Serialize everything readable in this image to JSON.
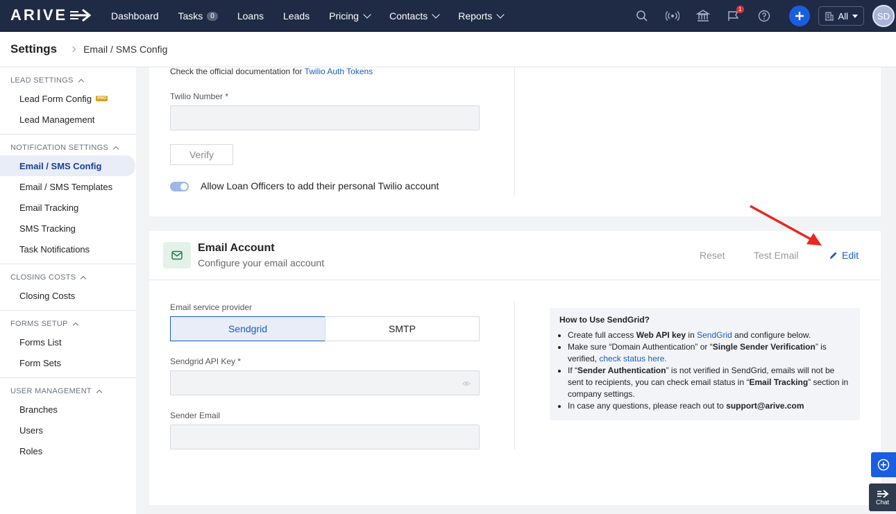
{
  "brand": {
    "logo_text": "ARIVE"
  },
  "nav": {
    "items": [
      {
        "label": "Dashboard"
      },
      {
        "label": "Tasks",
        "badge": "0"
      },
      {
        "label": "Loans"
      },
      {
        "label": "Leads"
      },
      {
        "label": "Pricing",
        "dropdown": true
      },
      {
        "label": "Contacts",
        "dropdown": true
      },
      {
        "label": "Reports",
        "dropdown": true
      }
    ],
    "notification_count": "1",
    "filter_label": "All",
    "avatar_initials": "SD"
  },
  "header": {
    "title": "Settings",
    "breadcrumb": "Email / SMS Config"
  },
  "sidebar": {
    "sections": [
      {
        "title": "LEAD SETTINGS",
        "items": [
          {
            "label": "Lead Form Config",
            "tag": "PRO"
          },
          {
            "label": "Lead Management"
          }
        ]
      },
      {
        "title": "NOTIFICATION SETTINGS",
        "items": [
          {
            "label": "Email / SMS Config",
            "active": true
          },
          {
            "label": "Email / SMS Templates"
          },
          {
            "label": "Email Tracking"
          },
          {
            "label": "SMS Tracking"
          },
          {
            "label": "Task Notifications"
          }
        ]
      },
      {
        "title": "CLOSING COSTS",
        "items": [
          {
            "label": "Closing Costs"
          }
        ]
      },
      {
        "title": "FORMS SETUP",
        "items": [
          {
            "label": "Forms List"
          },
          {
            "label": "Form Sets"
          }
        ]
      },
      {
        "title": "USER MANAGEMENT",
        "items": [
          {
            "label": "Branches"
          },
          {
            "label": "Users"
          },
          {
            "label": "Roles"
          }
        ]
      }
    ]
  },
  "twilio": {
    "doc_text": "Check the official documentation for ",
    "doc_link": "Twilio Auth Tokens",
    "number_label": "Twilio Number *",
    "number_value": "",
    "verify_label": "Verify",
    "toggle_label": "Allow Loan Officers to add their personal Twilio account",
    "toggle_on": true
  },
  "email_account": {
    "title": "Email Account",
    "subtitle": "Configure your email account",
    "reset_label": "Reset",
    "test_label": "Test Email",
    "edit_label": "Edit",
    "provider_label": "Email service provider",
    "providers": [
      "Sendgrid",
      "SMTP"
    ],
    "selected_provider": "Sendgrid",
    "api_key_label": "Sendgrid API Key *",
    "api_key_value": "",
    "sender_label": "Sender Email",
    "sender_value": ""
  },
  "howto": {
    "title": "How to Use SendGrid?",
    "l1a": "Create full access ",
    "l1b": "Web API key",
    "l1c": " in ",
    "l1d": "SendGrid",
    "l1e": " and configure below.",
    "l2a": "Make sure “Domain Authentication” or “",
    "l2b": "Single Sender Verification",
    "l2c": "” is verified, ",
    "l2d": "check status here.",
    "l3a": "If “",
    "l3b": "Sender Authentication",
    "l3c": "” is not verified in SendGrid, emails will not be sent to recipients, you can check email status in “",
    "l3d": "Email Tracking",
    "l3e": "” section in company settings.",
    "l4a": "In case any questions, please reach out to ",
    "l4b": "support@arive.com"
  },
  "chat_label": "Chat",
  "colors": {
    "nav_bg": "#1f2a44",
    "accent": "#1a5dbb",
    "primary_btn": "#1a5de0",
    "annotation_arrow": "#e8281e"
  }
}
